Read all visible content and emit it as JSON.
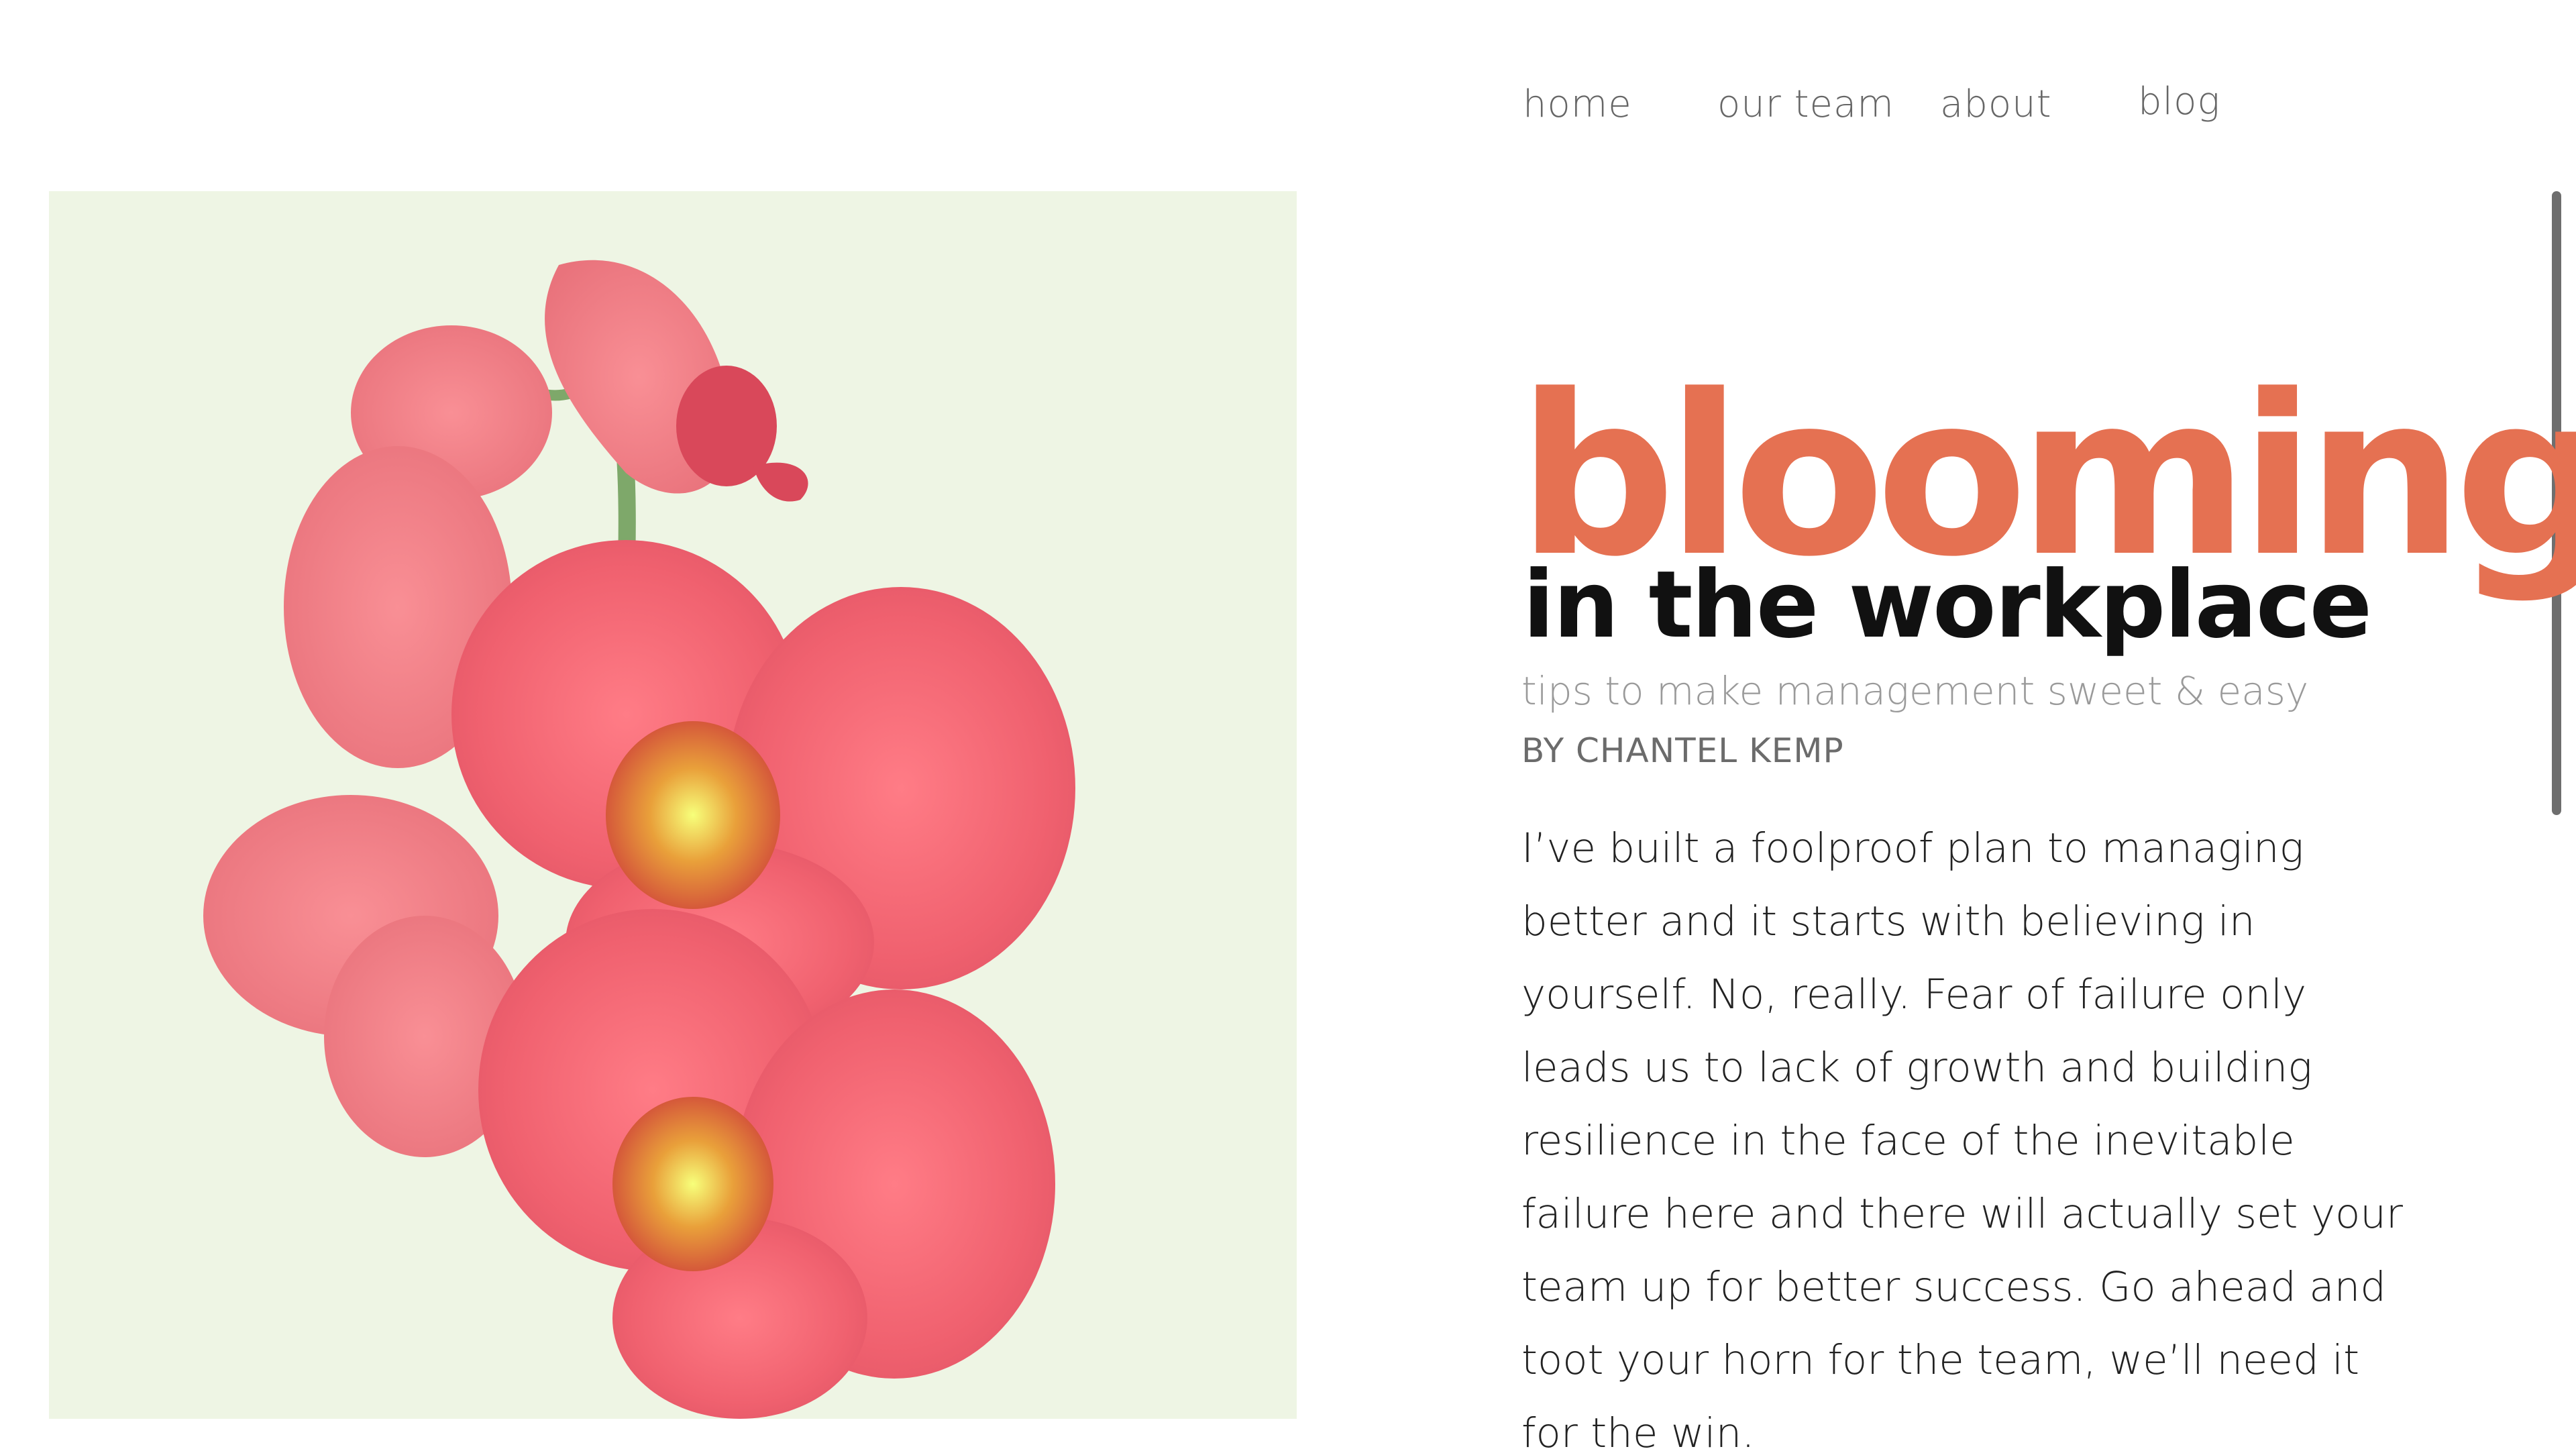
{
  "nav": {
    "home": "home",
    "our_team": "our team",
    "about": "about",
    "blog": "blog"
  },
  "hero": {
    "image_subject": "pink orchid flowers on a pale green background",
    "icon": "orchid-image"
  },
  "article": {
    "title": "blooming",
    "subtitle": "in the workplace",
    "tagline": "tips to make management sweet & easy",
    "byline": "BY CHANTEL KEMP",
    "body": "I’ve built a foolproof plan to managing better and it starts with believing in yourself. No, really. Fear of failure only leads us to lack of growth and building resilience in the face of the inevitable failure here and there will actually set your team up for better success. Go ahead and toot your horn for the team, we’ll need it for the win."
  },
  "colors": {
    "accent": "#e57152",
    "background": "#ffffff",
    "image_background": "#eef5e4",
    "nav_text": "#666666",
    "body_text": "#222222"
  }
}
